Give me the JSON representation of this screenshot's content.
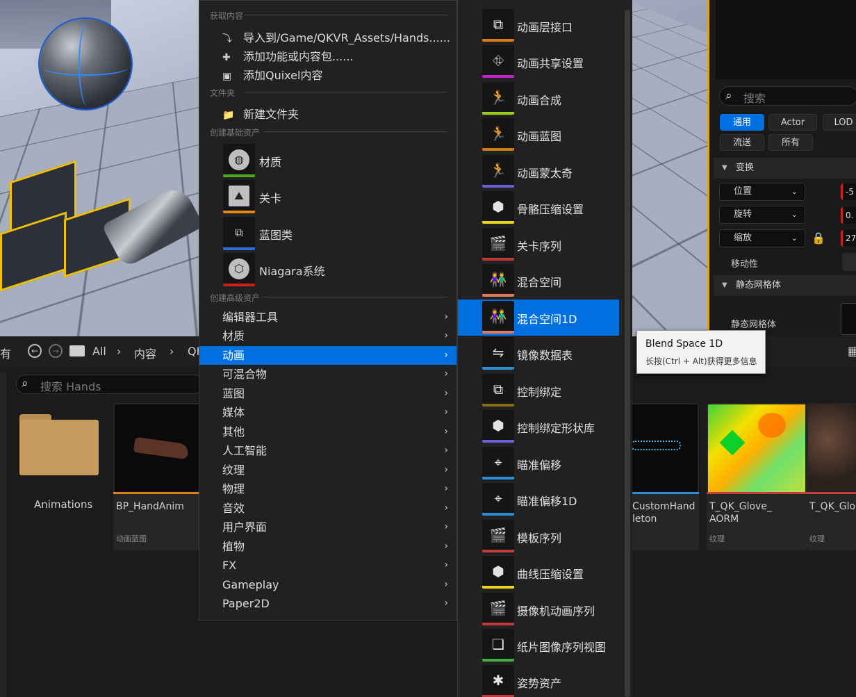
{
  "viewport": {},
  "details": {
    "search_placeholder": "搜索",
    "filter_tabs": [
      "通用",
      "Actor",
      "LOD",
      "流送",
      "所有"
    ],
    "sections": {
      "transform": "变换",
      "static_mesh": "静态网格体"
    },
    "transform_props": [
      "位置",
      "旋转",
      "缩放"
    ],
    "transform_values": [
      "-5",
      "0.",
      "27"
    ],
    "mobility_label": "移动性",
    "static_mesh_label": "静态网格体"
  },
  "browser": {
    "nav_truncated": "有",
    "crumb_all": "All",
    "crumb_content": "内容",
    "crumb_trunc": "QK",
    "search_placeholder": "搜索 Hands",
    "folder_name": "Animations",
    "assets": [
      {
        "name": "BP_HandAnim",
        "type": "动画蓝图",
        "accent": "#e0801a"
      },
      {
        "name": "CustomHand\nleton",
        "type": "",
        "accent": "#2a8fd6"
      },
      {
        "name": "T_QK_Glove_\nAORM",
        "type": "纹理",
        "accent": "#c23b3b"
      },
      {
        "name": "T_QK_Glo",
        "type": "纹理",
        "accent": "#c23b3b"
      }
    ]
  },
  "menu": {
    "headers": {
      "get_content": "获取内容",
      "folder": "文件夹",
      "basic_assets": "创建基础资产",
      "advanced_assets": "创建高级资产"
    },
    "get_content_items": [
      "导入到/Game/QKVR_Assets/Hands......",
      "添加功能或内容包......",
      "添加Quixel内容"
    ],
    "new_folder": "新建文件夹",
    "basic_items": [
      {
        "label": "材质",
        "color": "#4caf1e"
      },
      {
        "label": "关卡",
        "color": "#e08a12"
      },
      {
        "label": "蓝图类",
        "color": "#2f6fe0"
      },
      {
        "label": "Niagara系统",
        "color": "#d41c1c"
      }
    ],
    "submenus": [
      "编辑器工具",
      "材质",
      "动画",
      "可混合物",
      "蓝图",
      "媒体",
      "其他",
      "人工智能",
      "纹理",
      "物理",
      "音效",
      "用户界面",
      "植物",
      "FX",
      "Gameplay",
      "Paper2D"
    ],
    "active_submenu": "动画"
  },
  "anim_menu": {
    "items": [
      {
        "label": "动画层接口",
        "color": "#d97a12"
      },
      {
        "label": "动画共享设置",
        "color": "#c21fc9"
      },
      {
        "label": "动画合成",
        "color": "#9ccc1a"
      },
      {
        "label": "动画蓝图",
        "color": "#d07a12"
      },
      {
        "label": "动画蒙太奇",
        "color": "#6b5fd9"
      },
      {
        "label": "骨骼压缩设置",
        "color": "#e8d21a"
      },
      {
        "label": "关卡序列",
        "color": "#c23b3b"
      },
      {
        "label": "混合空间",
        "color": "#e07a5a"
      },
      {
        "label": "混合空间1D",
        "color": "#e07a5a"
      },
      {
        "label": "镜像数据表",
        "color": "#2a8fd6"
      },
      {
        "label": "控制绑定",
        "color": "#8a6a12"
      },
      {
        "label": "控制绑定形状库",
        "color": "#6b5fd9"
      },
      {
        "label": "瞄准偏移",
        "color": "#2a8fd6"
      },
      {
        "label": "瞄准偏移1D",
        "color": "#2a8fd6"
      },
      {
        "label": "模板序列",
        "color": "#c23b3b"
      },
      {
        "label": "曲线压缩设置",
        "color": "#e8d21a"
      },
      {
        "label": "摄像机动画序列",
        "color": "#c23b3b"
      },
      {
        "label": "纸片图像序列视图",
        "color": "#3fae3f"
      },
      {
        "label": "姿势资产",
        "color": "#c23b3b"
      }
    ],
    "active_item": "混合空间1D"
  },
  "tooltip": {
    "title": "Blend Space 1D",
    "hint": "长按(Ctrl + Alt)获得更多信息"
  }
}
